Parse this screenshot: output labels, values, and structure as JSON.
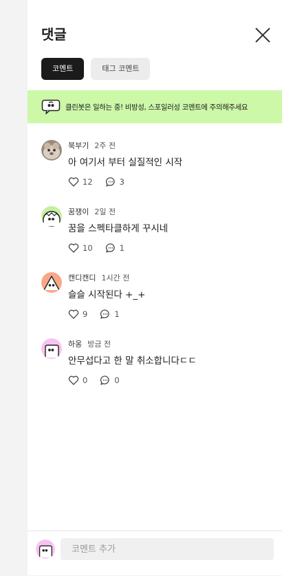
{
  "header": {
    "title": "댓글"
  },
  "tabs": [
    {
      "label": "코멘트",
      "active": true
    },
    {
      "label": "태그 코멘트",
      "active": false
    }
  ],
  "notice": {
    "text": "클린봇은 일하는 중! 비방성, 스포일러성 코멘트에 주의해주세요",
    "background": "#ccf8a8"
  },
  "comments": [
    {
      "author": "북부기",
      "time": "2주 전",
      "text": "아 여기서 부터 실질적인 시작",
      "likes": "12",
      "replies": "3",
      "avatar": "photo-avatar"
    },
    {
      "author": "꿈쟁이",
      "time": "2일 전",
      "text": "꿈을 스펙타클하게 꾸시네",
      "likes": "10",
      "replies": "1",
      "avatar": "green-character-avatar"
    },
    {
      "author": "캔디캔디",
      "time": "1시간 전",
      "text": "슬슬 시작된다 +_+",
      "likes": "9",
      "replies": "1",
      "avatar": "orange-character-avatar"
    },
    {
      "author": "하옹",
      "time": "방금 전",
      "text": "안무섭다고 한 말 취소합니다ㄷㄷ",
      "likes": "0",
      "replies": "0",
      "avatar": "pink-character-avatar"
    }
  ],
  "footer": {
    "placeholder": "코멘트 추가"
  }
}
